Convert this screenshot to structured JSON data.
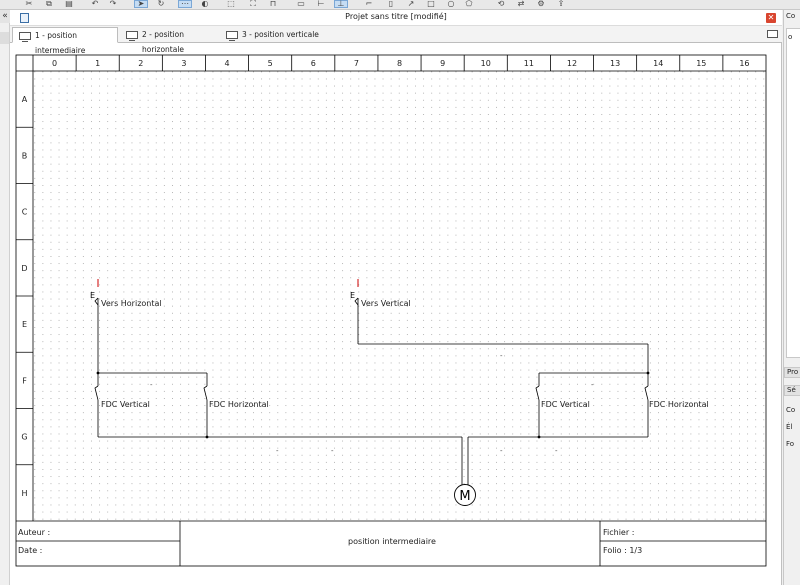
{
  "window": {
    "title": "Projet sans titre [modifié]",
    "close_glyph": "✕"
  },
  "tabs": [
    {
      "label": "1 - position intermediaire",
      "active": true
    },
    {
      "label": "2 - position horizontale",
      "active": false
    },
    {
      "label": "3 - position verticale",
      "active": false
    }
  ],
  "grid": {
    "columns": [
      "0",
      "1",
      "2",
      "3",
      "4",
      "5",
      "6",
      "7",
      "8",
      "9",
      "10",
      "11",
      "12",
      "13",
      "14",
      "15",
      "16"
    ],
    "rows": [
      "A",
      "B",
      "C",
      "D",
      "E",
      "F",
      "G",
      "H"
    ]
  },
  "schematic": {
    "labels": {
      "vers_horizontal": "Vers Horizontal",
      "vers_vertical": "Vers Vertical",
      "fdc_vertical_left": "FDC Vertical",
      "fdc_horizontal_left": "FDC Horizontal",
      "fdc_vertical_right": "FDC Vertical",
      "fdc_horizontal_right": "FDC Horizontal",
      "motor": "M",
      "e_left": "E",
      "e_right": "E",
      "wire_dash": "-"
    }
  },
  "cartouche": {
    "author_label": "Auteur :",
    "date_label": "Date :",
    "title": "position intermediaire",
    "file_label": "Fichier :",
    "folio_label": "Folio : 1/3"
  },
  "right_panel": {
    "top": "Co",
    "search_fragment": "o",
    "tab1": "Pro",
    "tab2": "Sé",
    "row1": "Co",
    "row2": "Él",
    "row3": "Fo"
  },
  "left_strip": {
    "collapse_glyph": "«"
  },
  "colors": {
    "frame": "#000000",
    "grid_dot": "#a8a8a8",
    "close_red": "#d9452f",
    "active_tool": "#c5dcf3",
    "terminal_red": "#cc0000"
  }
}
